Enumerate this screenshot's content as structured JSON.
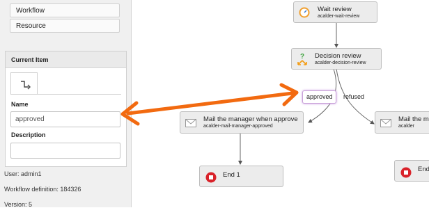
{
  "sidebar": {
    "workflow_button": "Workflow",
    "resource_button": "Resource",
    "current_item": {
      "title": "Current Item",
      "name_label": "Name",
      "name_value": "approved",
      "description_label": "Description",
      "description_value": ""
    },
    "user": "User: admin1",
    "workflow_definition": "Workflow definition: 184326",
    "version": "Version: 5"
  },
  "diagram": {
    "nodes": {
      "wait_review": {
        "title": "Wait review",
        "subtitle": "acalder-wait-review"
      },
      "decision_review": {
        "title": "Decision review",
        "subtitle": "acalder-decision-review"
      },
      "mail_approved": {
        "title": "Mail the manager when approve",
        "subtitle": "acalder-mail-manager-approved"
      },
      "mail_refused": {
        "title": "Mail the m",
        "subtitle": "acalder"
      },
      "end1": {
        "title": "End 1"
      },
      "end2": {
        "title": "End"
      }
    },
    "edges": {
      "approved": "approved",
      "refused": "refused"
    }
  },
  "colors": {
    "annotation_arrow": "#f26a10",
    "end_icon": "#d9222a",
    "decision_green": "#3aa23a",
    "decision_orange": "#f39c12",
    "clock_orange": "#f0a030"
  }
}
